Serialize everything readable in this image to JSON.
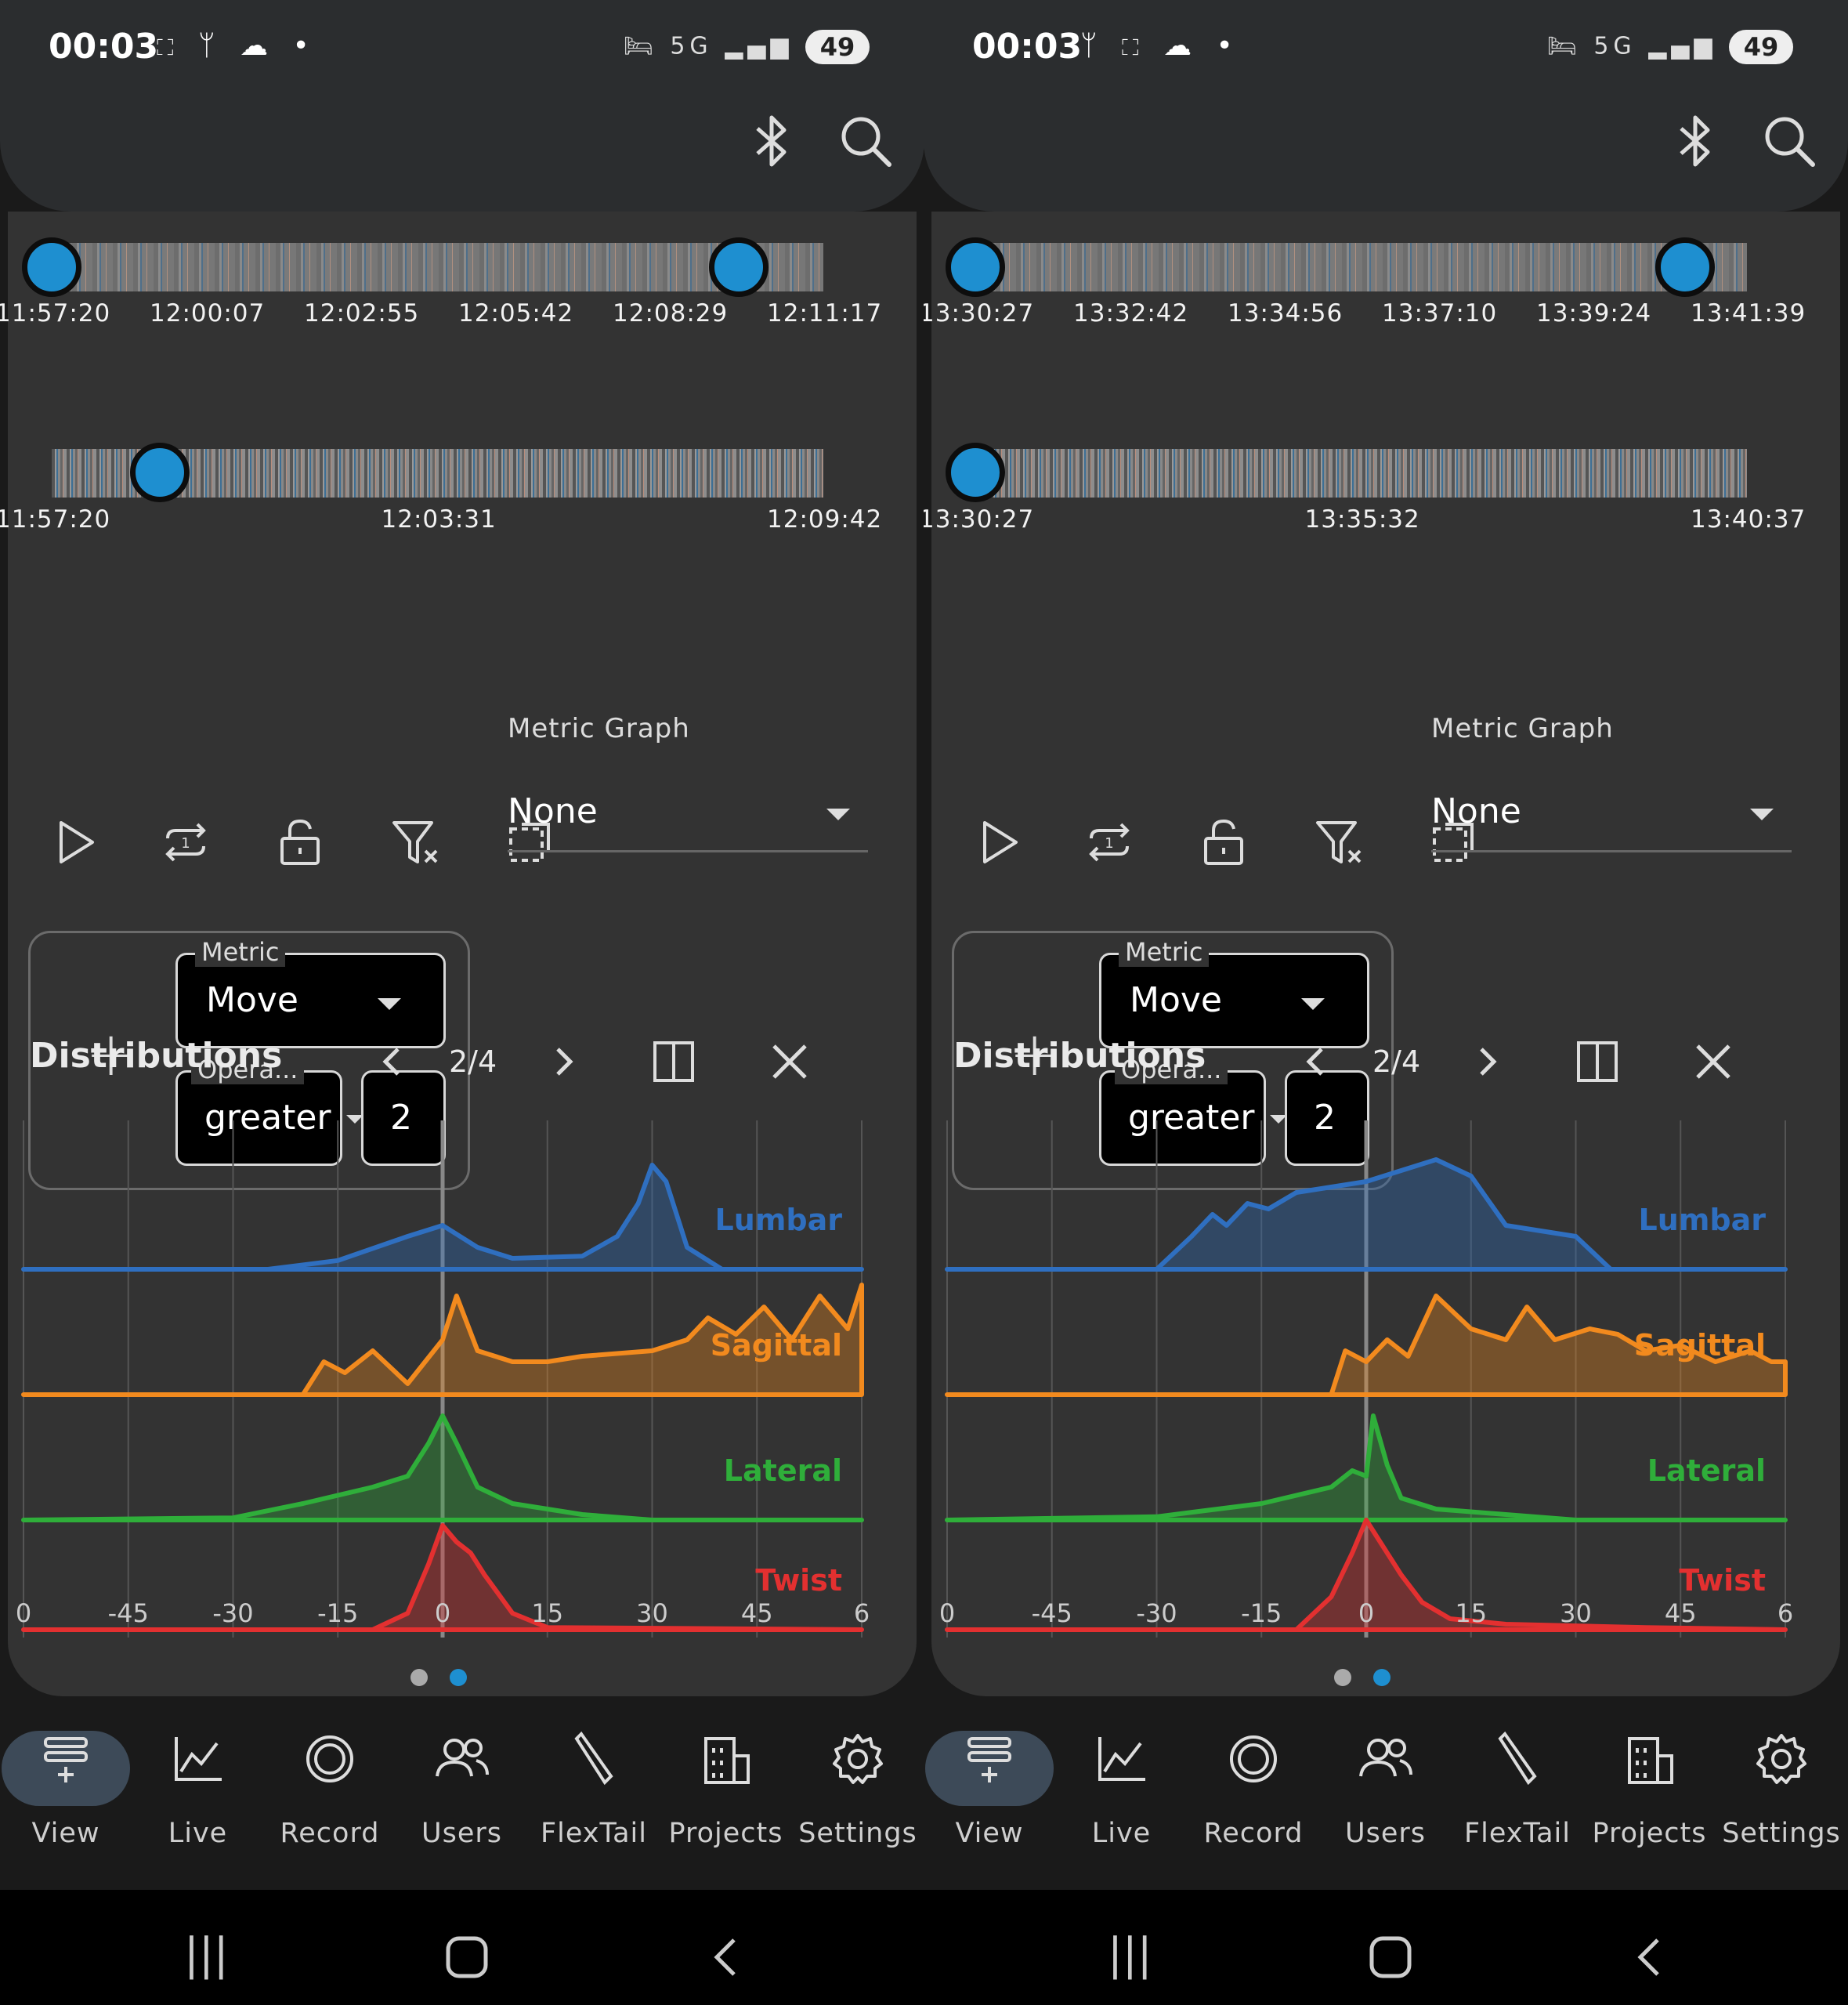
{
  "screens": [
    {
      "status": {
        "time": "00:03",
        "left_icons": "⛶ ᛘ ☁ •",
        "network": "5G",
        "battery": "49"
      },
      "timeline_top": {
        "labels": [
          "11:57:20",
          "12:00:07",
          "12:02:55",
          "12:05:42",
          "12:08:29",
          "12:11:17"
        ],
        "range_start_fraction": 0.0,
        "range_end_fraction": 0.89
      },
      "timeline_bottom": {
        "labels": [
          "11:57:20",
          "12:03:31",
          "12:09:42"
        ],
        "position_fraction": 0.14
      },
      "filter": {
        "metric_label": "Metric",
        "metric_value": "Move",
        "operator_label": "Opera...",
        "operator_value": "greater",
        "value": "2"
      },
      "metric_graph": {
        "label": "Metric Graph",
        "value": "None"
      },
      "distributions": {
        "title": "Distributions",
        "page": "2/4"
      },
      "chart_data": {
        "type": "area",
        "x_ticks": [
          "0",
          "-45",
          "-30",
          "-15",
          "0",
          "15",
          "30",
          "45",
          "6"
        ],
        "series": [
          {
            "name": "Lumbar",
            "color": "#2f6fc0",
            "x": [
              -60,
              -25,
              -15,
              -5,
              0,
              5,
              10,
              20,
              25,
              28,
              30,
              32,
              35,
              40,
              60
            ],
            "y": [
              0,
              0,
              0.08,
              0.3,
              0.4,
              0.2,
              0.1,
              0.12,
              0.3,
              0.6,
              0.95,
              0.8,
              0.2,
              0,
              0
            ]
          },
          {
            "name": "Sagittal",
            "color": "#f28a1e",
            "x": [
              -60,
              -20,
              -17,
              -14,
              -10,
              -5,
              0,
              2,
              5,
              10,
              15,
              20,
              30,
              35,
              38,
              42,
              46,
              50,
              54,
              58,
              60
            ],
            "y": [
              0,
              0,
              0.3,
              0.2,
              0.4,
              0.1,
              0.5,
              0.9,
              0.4,
              0.3,
              0.3,
              0.35,
              0.4,
              0.5,
              0.7,
              0.55,
              0.8,
              0.5,
              0.9,
              0.6,
              1.0
            ]
          },
          {
            "name": "Lateral",
            "color": "#2fae3a",
            "x": [
              -60,
              -30,
              -20,
              -10,
              -5,
              -2,
              0,
              2,
              5,
              10,
              20,
              30,
              60
            ],
            "y": [
              0,
              0.02,
              0.15,
              0.3,
              0.4,
              0.7,
              0.95,
              0.7,
              0.3,
              0.15,
              0.05,
              0,
              0
            ]
          },
          {
            "name": "Twist",
            "color": "#e33030",
            "x": [
              -60,
              -10,
              -5,
              -2,
              0,
              2,
              4,
              6,
              10,
              15,
              60
            ],
            "y": [
              0,
              0,
              0.15,
              0.6,
              0.95,
              0.8,
              0.7,
              0.5,
              0.15,
              0.02,
              0
            ]
          }
        ]
      }
    },
    {
      "status": {
        "time": "00:03",
        "left_icons": "ᛘ ⛶ ☁ •",
        "network": "5G",
        "battery": "49"
      },
      "timeline_top": {
        "labels": [
          "13:30:27",
          "13:32:42",
          "13:34:56",
          "13:37:10",
          "13:39:24",
          "13:41:39"
        ],
        "range_start_fraction": 0.0,
        "range_end_fraction": 0.92
      },
      "timeline_bottom": {
        "labels": [
          "13:30:27",
          "13:35:32",
          "13:40:37"
        ],
        "position_fraction": 0.0
      },
      "filter": {
        "metric_label": "Metric",
        "metric_value": "Move",
        "operator_label": "Opera...",
        "operator_value": "greater",
        "value": "2"
      },
      "metric_graph": {
        "label": "Metric Graph",
        "value": "None"
      },
      "distributions": {
        "title": "Distributions",
        "page": "2/4"
      },
      "chart_data": {
        "type": "area",
        "x_ticks": [
          "0",
          "-45",
          "-30",
          "-15",
          "0",
          "15",
          "30",
          "45",
          "6"
        ],
        "series": [
          {
            "name": "Lumbar",
            "color": "#2f6fc0",
            "x": [
              -60,
              -30,
              -25,
              -22,
              -20,
              -17,
              -14,
              -10,
              -5,
              0,
              5,
              10,
              15,
              20,
              25,
              30,
              35,
              60
            ],
            "y": [
              0,
              0,
              0.3,
              0.5,
              0.4,
              0.6,
              0.55,
              0.7,
              0.75,
              0.8,
              0.9,
              1.0,
              0.85,
              0.4,
              0.35,
              0.3,
              0,
              0
            ]
          },
          {
            "name": "Sagittal",
            "color": "#f28a1e",
            "x": [
              -60,
              -5,
              -3,
              0,
              3,
              6,
              10,
              15,
              20,
              23,
              27,
              32,
              36,
              40,
              45,
              50,
              55,
              58,
              60
            ],
            "y": [
              0,
              0,
              0.4,
              0.3,
              0.5,
              0.35,
              0.9,
              0.6,
              0.5,
              0.8,
              0.5,
              0.6,
              0.55,
              0.4,
              0.45,
              0.3,
              0.4,
              0.3,
              0.3
            ]
          },
          {
            "name": "Lateral",
            "color": "#2fae3a",
            "x": [
              -60,
              -30,
              -15,
              -5,
              -2,
              0,
              1,
              3,
              5,
              10,
              20,
              30,
              60
            ],
            "y": [
              0,
              0.03,
              0.15,
              0.3,
              0.45,
              0.4,
              0.95,
              0.5,
              0.2,
              0.1,
              0.05,
              0,
              0
            ]
          },
          {
            "name": "Twist",
            "color": "#e33030",
            "x": [
              -60,
              -10,
              -5,
              -2,
              0,
              2,
              5,
              8,
              12,
              20,
              40,
              60
            ],
            "y": [
              0,
              0,
              0.3,
              0.7,
              1.0,
              0.8,
              0.5,
              0.25,
              0.1,
              0.05,
              0.02,
              0
            ]
          }
        ]
      }
    }
  ],
  "nav": [
    "View",
    "Live",
    "Record",
    "Users",
    "FlexTail",
    "Projects",
    "Settings"
  ],
  "icons": {
    "appbar": [
      "bluetooth-icon",
      "search-icon"
    ],
    "tools": [
      "play-icon",
      "repeat-one-icon",
      "unlock-icon",
      "filter-clear-icon",
      "crop-select-icon"
    ],
    "nav": [
      "view-list-icon",
      "chart-line-icon",
      "record-icon",
      "users-icon",
      "flextail-icon",
      "projects-building-icon",
      "settings-gear-icon"
    ]
  }
}
